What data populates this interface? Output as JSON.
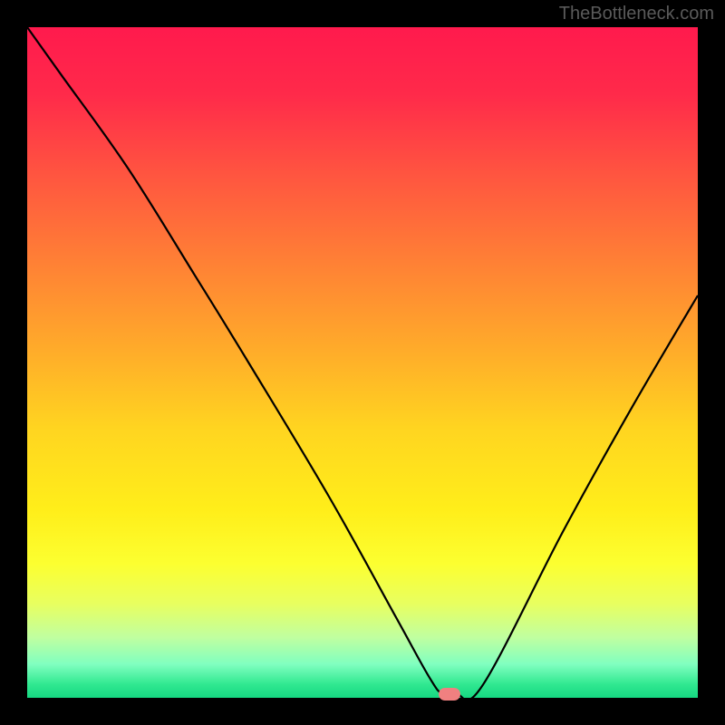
{
  "watermark": "TheBottleneck.com",
  "chart_data": {
    "type": "line",
    "title": "",
    "xlabel": "",
    "ylabel": "",
    "xlim": [
      0,
      100
    ],
    "ylim": [
      0,
      100
    ],
    "grid": false,
    "legend": false,
    "background_gradient": {
      "top": "#ff1a4d",
      "bottom": "#16d882",
      "meaning": "red high to green low"
    },
    "series": [
      {
        "name": "bottleneck-curve",
        "color": "#000000",
        "x": [
          0,
          5,
          15,
          25,
          33,
          45,
          55,
          60,
          62,
          64,
          68,
          80,
          90,
          100
        ],
        "values": [
          100,
          93,
          79,
          63,
          50,
          30,
          12,
          3,
          0.5,
          0.5,
          2,
          25,
          43,
          60
        ]
      }
    ],
    "marker": {
      "name": "optimal-point",
      "x": 63,
      "y": 0.5,
      "color": "#f08080"
    }
  }
}
